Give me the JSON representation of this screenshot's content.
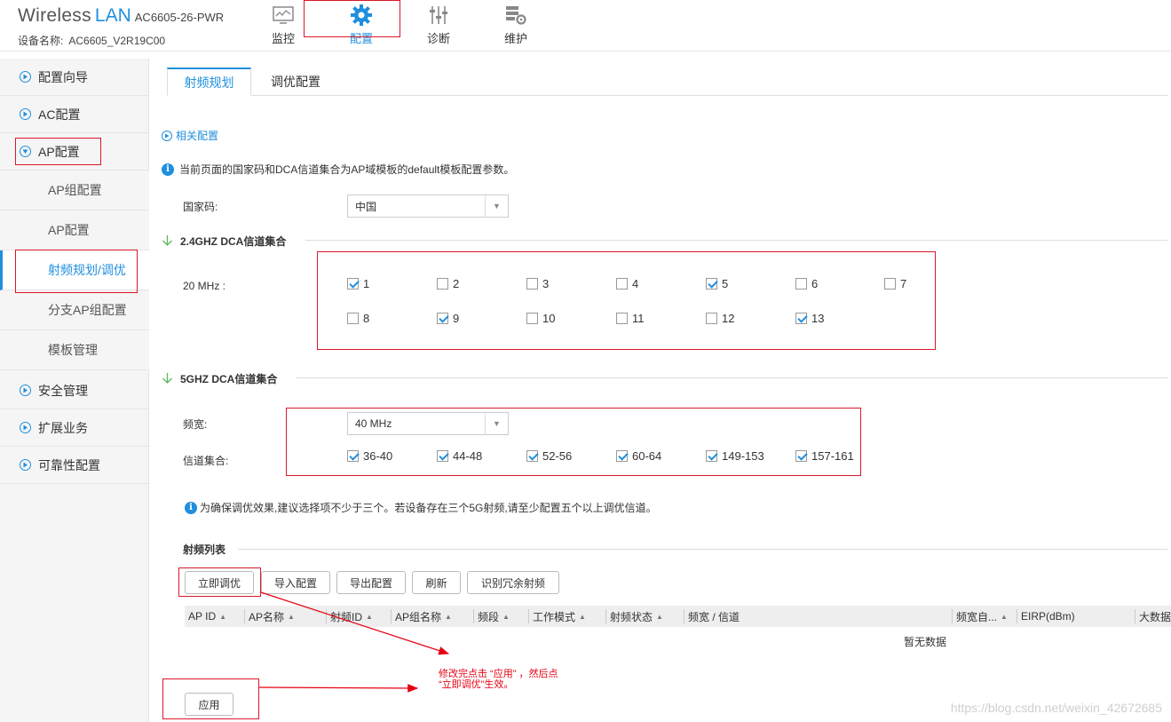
{
  "header": {
    "brand_wireless": "Wireless",
    "brand_lan": "LAN",
    "model": "AC6605-26-PWR",
    "device_label": "设备名称:",
    "device_name": "AC6605_V2R19C00",
    "nav": [
      {
        "label": "监控",
        "icon": "monitor-icon"
      },
      {
        "label": "配置",
        "icon": "gear-icon"
      },
      {
        "label": "诊断",
        "icon": "sliders-icon"
      },
      {
        "label": "维护",
        "icon": "maintenance-icon"
      }
    ]
  },
  "sidebar": {
    "items": [
      {
        "label": "配置向导"
      },
      {
        "label": "AC配置"
      },
      {
        "label": "AP配置"
      },
      {
        "label": "安全管理"
      },
      {
        "label": "扩展业务"
      },
      {
        "label": "可靠性配置"
      }
    ],
    "subitems": [
      {
        "label": "AP组配置"
      },
      {
        "label": "AP配置"
      },
      {
        "label": "射频规划/调优"
      },
      {
        "label": "分支AP组配置"
      },
      {
        "label": "模板管理"
      }
    ]
  },
  "tabs": [
    {
      "label": "射频规划"
    },
    {
      "label": "调优配置"
    }
  ],
  "content": {
    "related_config": "相关配置",
    "info_text": "当前页面的国家码和DCA信道集合为AP域模板的default模板配置参数。",
    "country_label": "国家码:",
    "country_value": "中国",
    "section_24": "2.4GHZ DCA信道集合",
    "mhz20_label": "20 MHz :",
    "channels_24": [
      {
        "label": "1",
        "checked": true
      },
      {
        "label": "2",
        "checked": false
      },
      {
        "label": "3",
        "checked": false
      },
      {
        "label": "4",
        "checked": false
      },
      {
        "label": "5",
        "checked": true
      },
      {
        "label": "6",
        "checked": false
      },
      {
        "label": "7",
        "checked": false
      },
      {
        "label": "8",
        "checked": false
      },
      {
        "label": "9",
        "checked": true
      },
      {
        "label": "10",
        "checked": false
      },
      {
        "label": "11",
        "checked": false
      },
      {
        "label": "12",
        "checked": false
      },
      {
        "label": "13",
        "checked": true
      }
    ],
    "section_5g": "5GHZ DCA信道集合",
    "bandwidth_label": "频宽:",
    "bandwidth_value": "40 MHz",
    "channelset_label": "信道集合:",
    "channels_5g": [
      {
        "label": "36-40",
        "checked": true
      },
      {
        "label": "44-48",
        "checked": true
      },
      {
        "label": "52-56",
        "checked": true
      },
      {
        "label": "60-64",
        "checked": true
      },
      {
        "label": "149-153",
        "checked": true
      },
      {
        "label": "157-161",
        "checked": true
      }
    ],
    "tip_text": "为确保调优效果,建议选择项不少于三个。若设备存在三个5G射频,请至少配置五个以上调优信道。",
    "radio_list_title": "射频列表",
    "buttons": [
      "立即调优",
      "导入配置",
      "导出配置",
      "刷新",
      "识别冗余射频"
    ],
    "columns": [
      "AP ID",
      "AP名称",
      "射频ID",
      "AP组名称",
      "频段",
      "工作模式",
      "射频状态",
      "频宽 / 信道",
      "频宽自...",
      "EIRP(dBm)",
      "大数据"
    ],
    "no_data": "暂无数据",
    "apply": "应用"
  },
  "annotation": {
    "line1": "修改完点击 “应用”   ，然后点",
    "line2": "“立即调优”生效。"
  },
  "watermark": "https://blog.csdn.net/weixin_42672685",
  "colors": {
    "accent": "#1f8fde",
    "highlight_red": "#d9182a"
  }
}
